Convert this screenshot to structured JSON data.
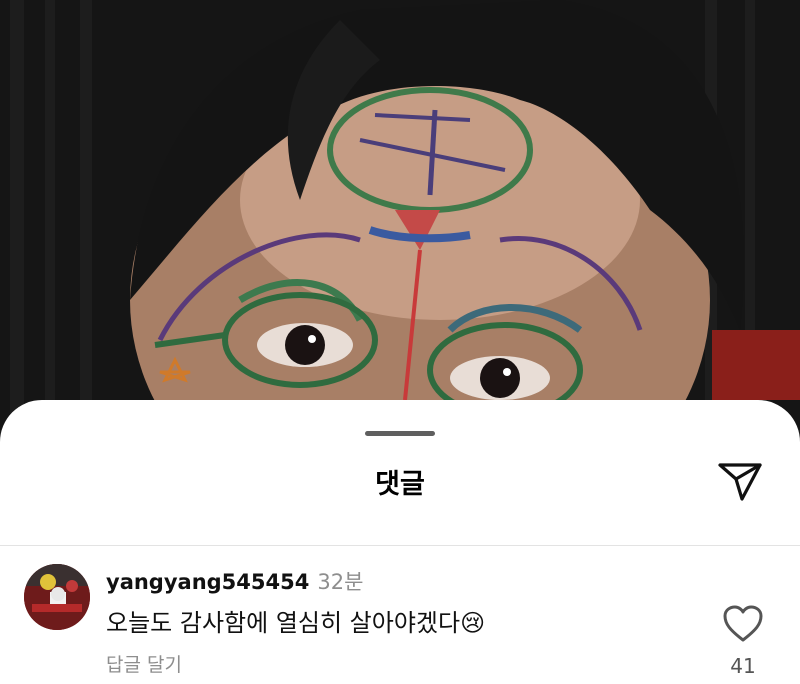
{
  "background_photo": {
    "description_icon": "selfie-photo"
  },
  "sheet": {
    "title": "댓글",
    "share_icon": "send-paper-plane-icon"
  },
  "comment": {
    "username": "yangyang545454",
    "timestamp": "32분",
    "text": "오늘도 감사함에 열심히 살아야겠다",
    "emoji": "😢",
    "reply_label": "답글 달기",
    "like_icon": "heart-outline-icon",
    "like_count": "41"
  },
  "colors": {
    "sheet_bg": "#ffffff",
    "muted_text": "#8e8e8e",
    "handle": "#5f5f5f"
  }
}
